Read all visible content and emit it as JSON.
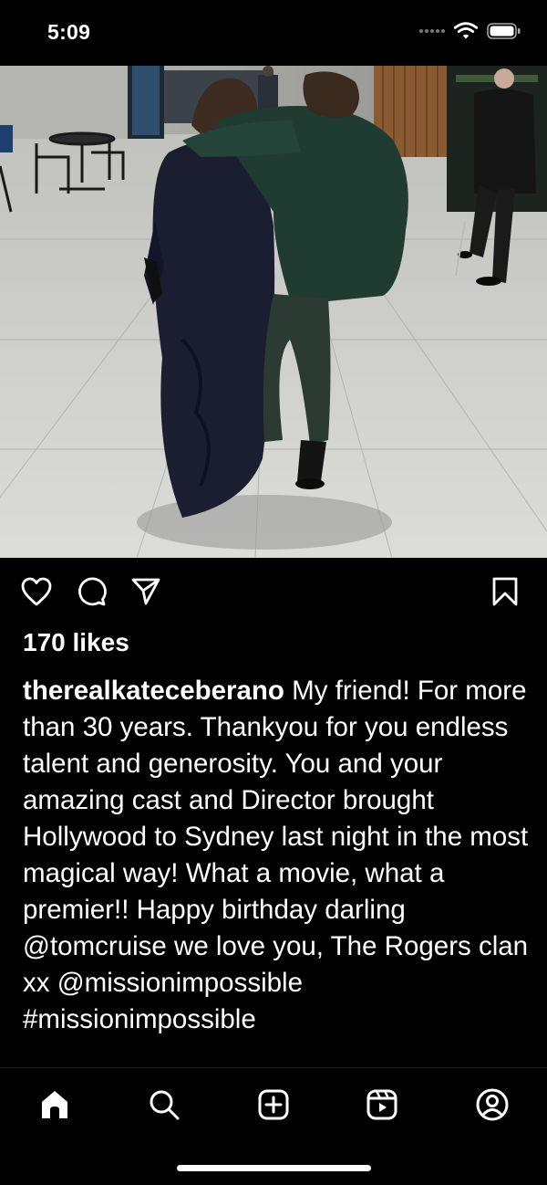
{
  "status_bar": {
    "time": "5:09",
    "icons": [
      "cellular-dots-icon",
      "wifi-icon",
      "battery-icon"
    ]
  },
  "post": {
    "photo": {
      "icon": "photo",
      "colors": {
        "floor": "#cfcfcc",
        "wall": "#a9a9a6",
        "wood": "#8a5a32",
        "woman_dress": "#1b1d30",
        "man_jacket": "#1f3b32",
        "man_pants": "#2b3a33"
      }
    },
    "actions": {
      "like_icon": "heart-icon",
      "comment_icon": "comment-icon",
      "share_icon": "send-icon",
      "save_icon": "bookmark-icon"
    },
    "likes_text": "170 likes",
    "caption": {
      "username": "therealkateceberano",
      "text": " My friend! For more than 30 years. Thankyou for you endless talent and generosity. You and your amazing cast and Director brought Hollywood to Sydney last night in the most magical way! What a movie, what a premier!! Happy birthday darling @tomcruise we love you, The Rogers clan xx @missionimpossible #missionimpossible"
    }
  },
  "tab_bar": {
    "items": [
      {
        "name": "home",
        "icon": "home-icon",
        "active": true
      },
      {
        "name": "search",
        "icon": "search-icon",
        "active": false
      },
      {
        "name": "create",
        "icon": "plus-square-icon",
        "active": false
      },
      {
        "name": "reels",
        "icon": "reels-icon",
        "active": false
      },
      {
        "name": "profile",
        "icon": "profile-icon",
        "active": false
      }
    ]
  },
  "theme": {
    "background": "#000000",
    "foreground": "#ffffff"
  }
}
